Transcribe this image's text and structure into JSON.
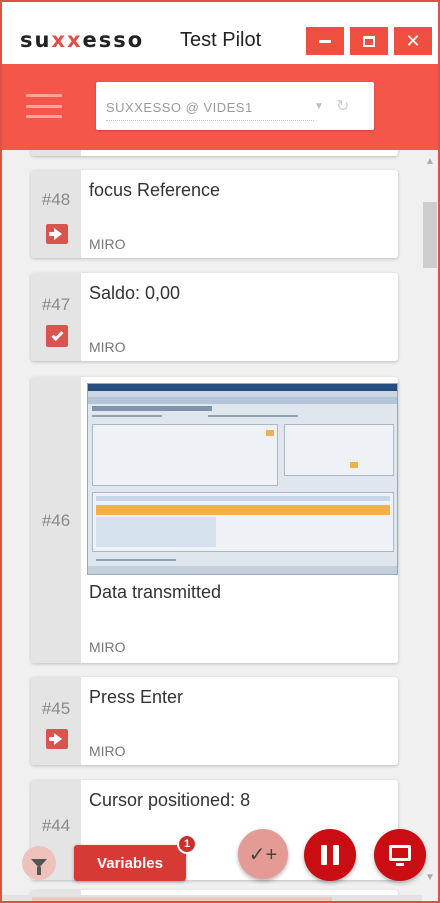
{
  "window": {
    "logo_pre": "su",
    "logo_mid": "xx",
    "logo_post": "esso",
    "title": "Test Pilot",
    "minimize_label": "–",
    "maximize_label": "□",
    "close_label": "✕"
  },
  "toolbar": {
    "menu_icon": "hamburger-icon",
    "project": "SUXXESSO @ VIDES1",
    "caret": "▼",
    "refresh": "↻"
  },
  "steps": [
    {
      "number": "#48",
      "title": "focus Reference",
      "module": "MIRO",
      "icon": "arrow-right-icon"
    },
    {
      "number": "#47",
      "title": "Saldo: 0,00",
      "module": "MIRO",
      "icon": "check-icon"
    },
    {
      "number": "#46",
      "title": "Data transmitted",
      "module": "MIRO",
      "icon": "screenshot-thumbnail"
    },
    {
      "number": "#45",
      "title": "Press Enter",
      "module": "MIRO",
      "icon": "arrow-right-icon"
    },
    {
      "number": "#44",
      "title": "Cursor positioned: 8",
      "module": "",
      "icon": ""
    }
  ],
  "bottom_bar": {
    "variables_label": "Variables",
    "variables_badge": "1",
    "checkpoint_icon": "✓+"
  },
  "colors": {
    "brand_red": "#f4574a",
    "accent_red": "#d9534f",
    "dark_red": "#c90d12"
  }
}
